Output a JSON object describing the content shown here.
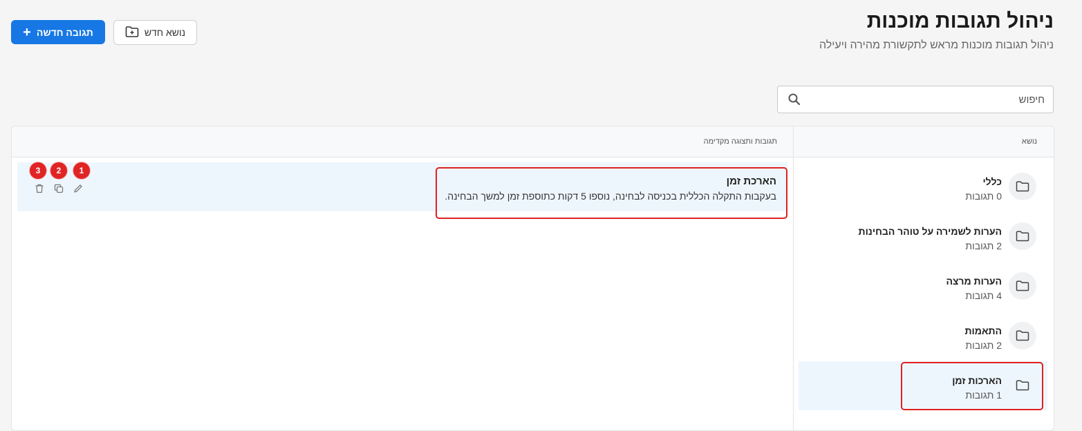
{
  "header": {
    "title": "ניהול תגובות מוכנות",
    "subtitle": "ניהול תגובות מוכנות מראש לתקשורת מהירה ויעילה"
  },
  "toolbar": {
    "new_answer_label": "תגובה חדשה",
    "new_topic_label": "נושא חדש"
  },
  "search": {
    "placeholder": "חיפוש"
  },
  "table": {
    "col_topic": "נושא",
    "col_answers": "תגובות ותצוגה מקדימה"
  },
  "topics": [
    {
      "name": "כללי",
      "count": "0 תגובות"
    },
    {
      "name": "הערות לשמירה על טוהר הבחינות",
      "count": "2 תגובות"
    },
    {
      "name": "הערות מרצה",
      "count": "4 תגובות"
    },
    {
      "name": "התאמות",
      "count": "2 תגובות"
    },
    {
      "name": "הארכות זמן",
      "count": "1 תגובות"
    }
  ],
  "answers": [
    {
      "title": "הארכת זמן",
      "text": "בעקבות התקלה הכללית בכניסה לבחינה, נוספו 5 דקות כתוספת זמן למשך הבחינה."
    }
  ],
  "annotations": [
    "1",
    "2",
    "3"
  ],
  "colors": {
    "accent": "#1677e5",
    "highlight": "#e02020",
    "selected_bg": "#eef6fd"
  },
  "icons": {
    "new_answer": "plus-icon",
    "new_topic": "folder-plus-icon",
    "search": "search-icon",
    "topic": "folder-icon",
    "edit": "pencil-icon",
    "copy": "copy-icon",
    "delete": "trash-icon"
  }
}
